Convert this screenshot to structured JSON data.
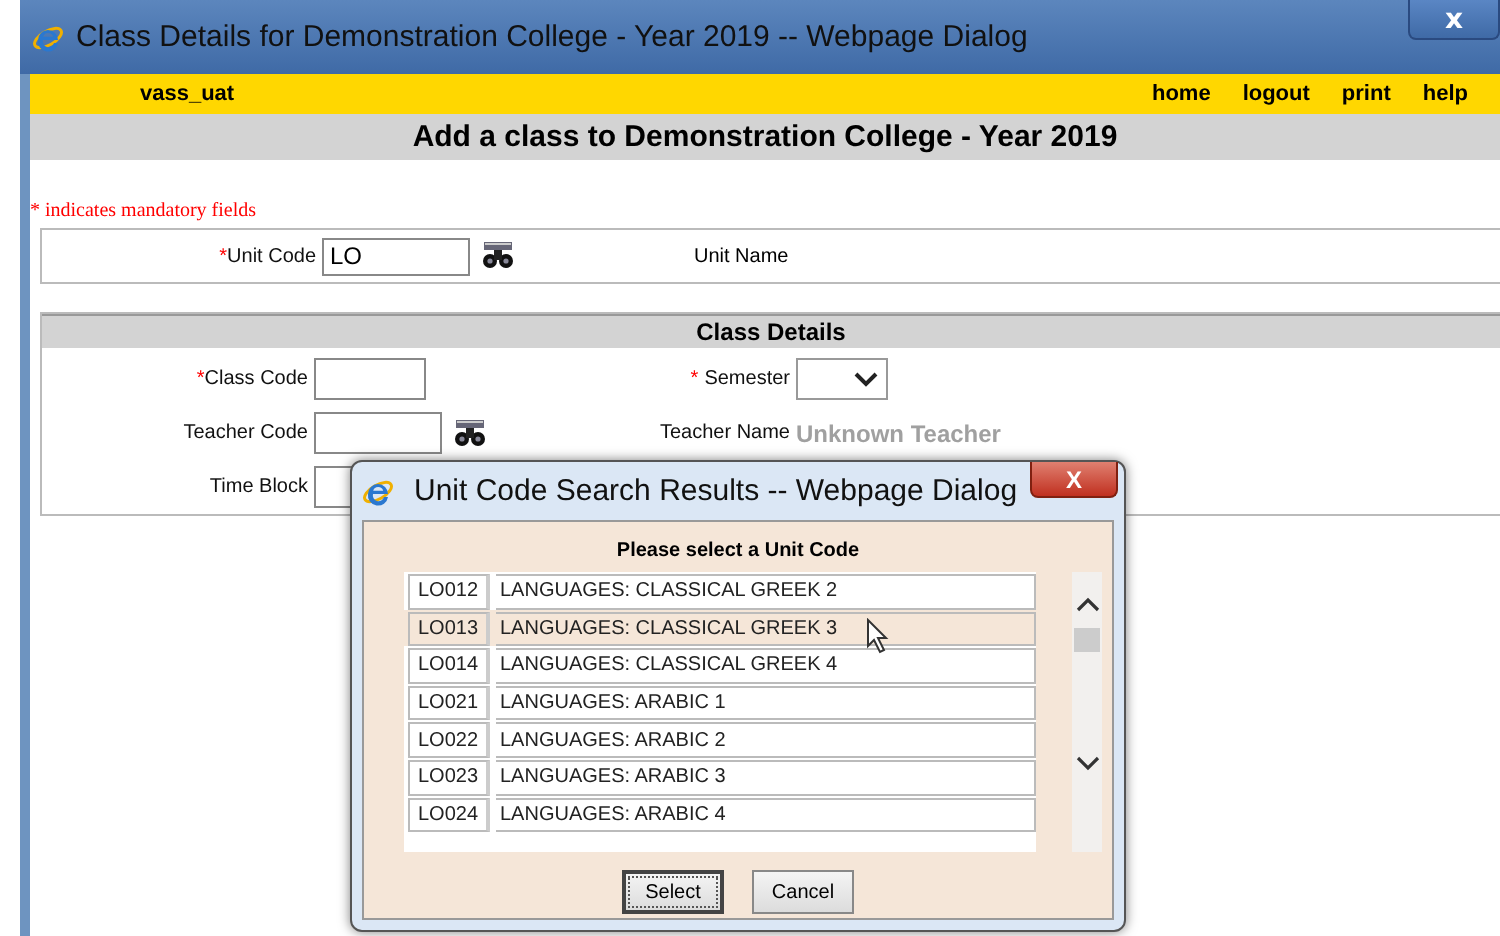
{
  "window": {
    "title": "Class Details for Demonstration College - Year 2019 -- Webpage Dialog",
    "close": "x"
  },
  "top_bar": {
    "user": "vass_uat",
    "links": [
      "home",
      "logout",
      "print",
      "help"
    ]
  },
  "heading": "Add a class to Demonstration College - Year 2019",
  "mandatory_note": "* indicates mandatory fields",
  "unit": {
    "code_mark": "*",
    "code_label": "Unit Code",
    "code_value": "LO",
    "name_label": "Unit Name"
  },
  "class_details": {
    "title": "Class Details",
    "class_code_mark": "*",
    "class_code_label": "Class Code",
    "semester_mark": "*",
    "semester_label": "Semester",
    "teacher_code_label": "Teacher Code",
    "teacher_name_label": "Teacher Name",
    "teacher_name_value": "Unknown Teacher",
    "time_block_label": "Time Block"
  },
  "dialog": {
    "title": "Unit Code Search Results -- Webpage Dialog",
    "close": "X",
    "prompt": "Please select a Unit Code",
    "rows": [
      {
        "code": "LO012",
        "name": "LANGUAGES: CLASSICAL GREEK 2",
        "selected": false
      },
      {
        "code": "LO013",
        "name": "LANGUAGES: CLASSICAL GREEK 3",
        "selected": true
      },
      {
        "code": "LO014",
        "name": "LANGUAGES: CLASSICAL GREEK 4",
        "selected": false
      },
      {
        "code": "LO021",
        "name": "LANGUAGES: ARABIC 1",
        "selected": false
      },
      {
        "code": "LO022",
        "name": "LANGUAGES: ARABIC 2",
        "selected": false
      },
      {
        "code": "LO023",
        "name": "LANGUAGES: ARABIC 3",
        "selected": false
      },
      {
        "code": "LO024",
        "name": "LANGUAGES: ARABIC 4",
        "selected": false
      }
    ],
    "buttons": [
      "Select",
      "Cancel"
    ]
  }
}
